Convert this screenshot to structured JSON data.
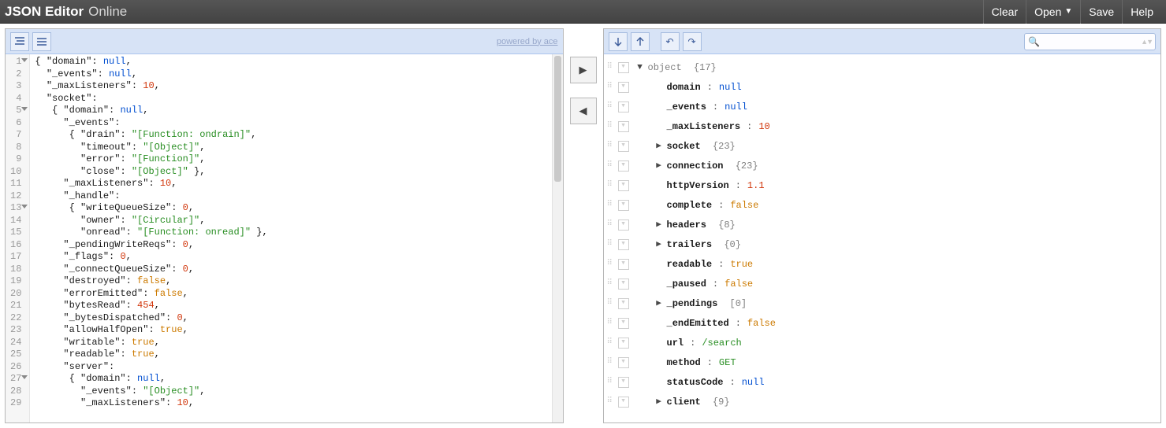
{
  "header": {
    "title_bold": "JSON Editor",
    "title_thin": "Online",
    "menu": {
      "clear": "Clear",
      "open": "Open",
      "save": "Save",
      "help": "Help"
    }
  },
  "left_toolbar": {
    "powered": "powered by ace"
  },
  "right_toolbar": {
    "search_placeholder": ""
  },
  "code_lines": [
    {
      "n": 1,
      "fold": true,
      "tokens": [
        "{ ",
        [
          "k",
          "\"domain\""
        ],
        ": ",
        [
          "u",
          "null"
        ],
        ","
      ]
    },
    {
      "n": 2,
      "tokens": [
        "  ",
        [
          "k",
          "\"_events\""
        ],
        ": ",
        [
          "u",
          "null"
        ],
        ","
      ]
    },
    {
      "n": 3,
      "tokens": [
        "  ",
        [
          "k",
          "\"_maxListeners\""
        ],
        ": ",
        [
          "n",
          "10"
        ],
        ","
      ]
    },
    {
      "n": 4,
      "tokens": [
        "  ",
        [
          "k",
          "\"socket\""
        ],
        ":"
      ]
    },
    {
      "n": 5,
      "fold": true,
      "tokens": [
        "   { ",
        [
          "k",
          "\"domain\""
        ],
        ": ",
        [
          "u",
          "null"
        ],
        ","
      ]
    },
    {
      "n": 6,
      "tokens": [
        "     ",
        [
          "k",
          "\"_events\""
        ],
        ":"
      ]
    },
    {
      "n": 7,
      "tokens": [
        "      { ",
        [
          "k",
          "\"drain\""
        ],
        ": ",
        [
          "s",
          "\"[Function: ondrain]\""
        ],
        ","
      ]
    },
    {
      "n": 8,
      "tokens": [
        "        ",
        [
          "k",
          "\"timeout\""
        ],
        ": ",
        [
          "s",
          "\"[Object]\""
        ],
        ","
      ]
    },
    {
      "n": 9,
      "tokens": [
        "        ",
        [
          "k",
          "\"error\""
        ],
        ": ",
        [
          "s",
          "\"[Function]\""
        ],
        ","
      ]
    },
    {
      "n": 10,
      "tokens": [
        "        ",
        [
          "k",
          "\"close\""
        ],
        ": ",
        [
          "s",
          "\"[Object]\""
        ],
        " },"
      ]
    },
    {
      "n": 11,
      "tokens": [
        "     ",
        [
          "k",
          "\"_maxListeners\""
        ],
        ": ",
        [
          "n",
          "10"
        ],
        ","
      ]
    },
    {
      "n": 12,
      "tokens": [
        "     ",
        [
          "k",
          "\"_handle\""
        ],
        ":"
      ]
    },
    {
      "n": 13,
      "fold": true,
      "tokens": [
        "      { ",
        [
          "k",
          "\"writeQueueSize\""
        ],
        ": ",
        [
          "n",
          "0"
        ],
        ","
      ]
    },
    {
      "n": 14,
      "tokens": [
        "        ",
        [
          "k",
          "\"owner\""
        ],
        ": ",
        [
          "s",
          "\"[Circular]\""
        ],
        ","
      ]
    },
    {
      "n": 15,
      "tokens": [
        "        ",
        [
          "k",
          "\"onread\""
        ],
        ": ",
        [
          "s",
          "\"[Function: onread]\""
        ],
        " },"
      ]
    },
    {
      "n": 16,
      "tokens": [
        "     ",
        [
          "k",
          "\"_pendingWriteReqs\""
        ],
        ": ",
        [
          "n",
          "0"
        ],
        ","
      ]
    },
    {
      "n": 17,
      "tokens": [
        "     ",
        [
          "k",
          "\"_flags\""
        ],
        ": ",
        [
          "n",
          "0"
        ],
        ","
      ]
    },
    {
      "n": 18,
      "tokens": [
        "     ",
        [
          "k",
          "\"_connectQueueSize\""
        ],
        ": ",
        [
          "n",
          "0"
        ],
        ","
      ]
    },
    {
      "n": 19,
      "tokens": [
        "     ",
        [
          "k",
          "\"destroyed\""
        ],
        ": ",
        [
          "b",
          "false"
        ],
        ","
      ]
    },
    {
      "n": 20,
      "tokens": [
        "     ",
        [
          "k",
          "\"errorEmitted\""
        ],
        ": ",
        [
          "b",
          "false"
        ],
        ","
      ]
    },
    {
      "n": 21,
      "tokens": [
        "     ",
        [
          "k",
          "\"bytesRead\""
        ],
        ": ",
        [
          "n",
          "454"
        ],
        ","
      ]
    },
    {
      "n": 22,
      "tokens": [
        "     ",
        [
          "k",
          "\"_bytesDispatched\""
        ],
        ": ",
        [
          "n",
          "0"
        ],
        ","
      ]
    },
    {
      "n": 23,
      "tokens": [
        "     ",
        [
          "k",
          "\"allowHalfOpen\""
        ],
        ": ",
        [
          "b",
          "true"
        ],
        ","
      ]
    },
    {
      "n": 24,
      "tokens": [
        "     ",
        [
          "k",
          "\"writable\""
        ],
        ": ",
        [
          "b",
          "true"
        ],
        ","
      ]
    },
    {
      "n": 25,
      "tokens": [
        "     ",
        [
          "k",
          "\"readable\""
        ],
        ": ",
        [
          "b",
          "true"
        ],
        ","
      ]
    },
    {
      "n": 26,
      "tokens": [
        "     ",
        [
          "k",
          "\"server\""
        ],
        ":"
      ]
    },
    {
      "n": 27,
      "fold": true,
      "tokens": [
        "      { ",
        [
          "k",
          "\"domain\""
        ],
        ": ",
        [
          "u",
          "null"
        ],
        ","
      ]
    },
    {
      "n": 28,
      "tokens": [
        "        ",
        [
          "k",
          "\"_events\""
        ],
        ": ",
        [
          "s",
          "\"[Object]\""
        ],
        ","
      ]
    },
    {
      "n": 29,
      "tokens": [
        "        ",
        [
          "k",
          "\"_maxListeners\""
        ],
        ": ",
        [
          "n",
          "10"
        ],
        ","
      ]
    }
  ],
  "tree_rows": [
    {
      "depth": 0,
      "caret": "down",
      "name": "object",
      "info": "{17}"
    },
    {
      "depth": 1,
      "name": "domain",
      "vtype": "null",
      "value": "null"
    },
    {
      "depth": 1,
      "name": "_events",
      "vtype": "null",
      "value": "null"
    },
    {
      "depth": 1,
      "name": "_maxListeners",
      "vtype": "num",
      "value": "10"
    },
    {
      "depth": 1,
      "caret": "right",
      "name": "socket",
      "info": "{23}"
    },
    {
      "depth": 1,
      "caret": "right",
      "name": "connection",
      "info": "{23}"
    },
    {
      "depth": 1,
      "name": "httpVersion",
      "vtype": "num",
      "value": "1.1"
    },
    {
      "depth": 1,
      "name": "complete",
      "vtype": "bool",
      "value": "false"
    },
    {
      "depth": 1,
      "caret": "right",
      "name": "headers",
      "info": "{8}"
    },
    {
      "depth": 1,
      "caret": "right",
      "name": "trailers",
      "info": "{0}"
    },
    {
      "depth": 1,
      "name": "readable",
      "vtype": "bool",
      "value": "true"
    },
    {
      "depth": 1,
      "name": "_paused",
      "vtype": "bool",
      "value": "false"
    },
    {
      "depth": 1,
      "caret": "right",
      "name": "_pendings",
      "info": "[0]"
    },
    {
      "depth": 1,
      "name": "_endEmitted",
      "vtype": "bool",
      "value": "false"
    },
    {
      "depth": 1,
      "name": "url",
      "vtype": "str",
      "value": "/search"
    },
    {
      "depth": 1,
      "name": "method",
      "vtype": "str",
      "value": "GET"
    },
    {
      "depth": 1,
      "name": "statusCode",
      "vtype": "null",
      "value": "null"
    },
    {
      "depth": 1,
      "caret": "right",
      "name": "client",
      "info": "{9}"
    }
  ]
}
